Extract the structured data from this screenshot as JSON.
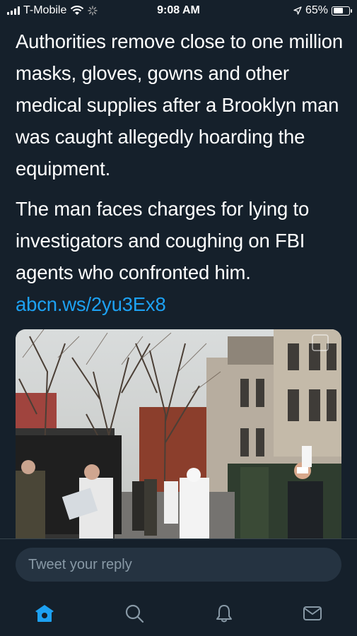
{
  "status_bar": {
    "carrier": "T-Mobile",
    "time": "9:08 AM",
    "battery": "65%",
    "battery_level": 0.65
  },
  "tweet": {
    "paragraph1": "Authorities remove close to one million masks, gloves, gowns and other medical supplies after a Brooklyn man was caught allegedly hoarding the equipment.",
    "paragraph2": "The man faces charges for lying to investigators and coughing on FBI agents who confronted him.",
    "link": "abcn.ws/2yu3Ex8"
  },
  "reply": {
    "placeholder": "Tweet your reply"
  },
  "tabs": [
    {
      "icon": "home-icon",
      "active": true
    },
    {
      "icon": "search-icon",
      "active": false
    },
    {
      "icon": "bell-icon",
      "active": false
    },
    {
      "icon": "mail-icon",
      "active": false
    }
  ],
  "colors": {
    "background": "#15202b",
    "accent": "#1da1f2",
    "input_background": "#253341",
    "muted": "#8899a6"
  }
}
